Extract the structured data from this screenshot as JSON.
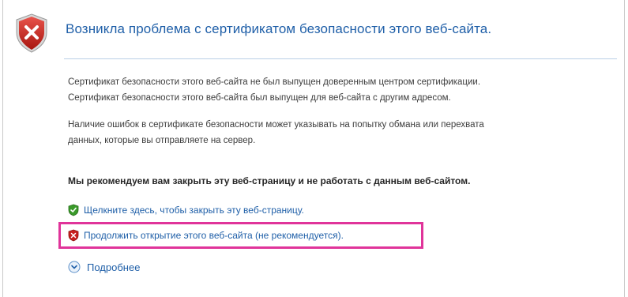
{
  "header": {
    "title": "Возникла проблема с сертификатом безопасности этого веб-сайта."
  },
  "paragraphs": {
    "p1_line1": "Сертификат безопасности этого веб-сайта не был выпущен доверенным центром сертификации.",
    "p1_line2": "Сертификат безопасности этого веб-сайта был выпущен для веб-сайта с другим адресом.",
    "p2_line1": "Наличие ошибок в сертификате безопасности может указывать на попытку обмана или перехвата",
    "p2_line2": "данных, которые вы отправляете на сервер."
  },
  "recommendation": "Мы рекомендуем вам закрыть эту веб-страницу и не работать с данным веб-сайтом.",
  "links": {
    "close_page": "Щелкните здесь, чтобы закрыть эту веб-страницу.",
    "continue_site": "Продолжить открытие этого веб-сайта (не рекомендуется).",
    "more_info": "Подробнее"
  },
  "icons": {
    "header": "shield-error-icon",
    "close_page": "green-shield-icon",
    "continue_site": "red-shield-icon",
    "more_info": "expand-circle-icon"
  },
  "colors": {
    "title": "#1f5fa8",
    "link": "#1f5fa8",
    "highlight": "#e0349a",
    "error_red": "#c8201e",
    "safe_green": "#3a9a2a"
  }
}
